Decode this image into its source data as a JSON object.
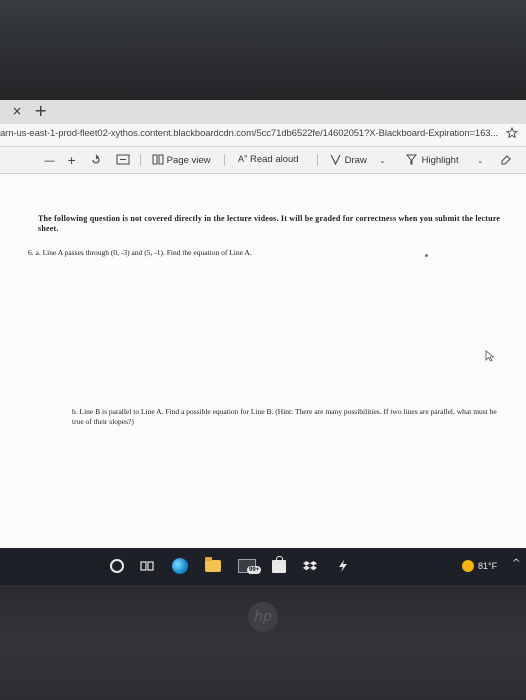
{
  "browser": {
    "tab_close_glyph": "×",
    "tab_new_glyph": "+",
    "url": "arn-us-east-1-prod-fleet02-xythos.content.blackboardcdn.com/5cc71db6522fe/14602051?X-Blackboard-Expiration=163...",
    "address_icon": "favorites-icon"
  },
  "pdf_toolbar": {
    "zoom_out": "—",
    "zoom_in": "+",
    "page_view_label": "Page view",
    "read_aloud_label": "Read aloud",
    "draw_label": "Draw",
    "highlight_label": "Highlight"
  },
  "document": {
    "instructions": "The following question is not covered directly in the lecture videos. It will be graded for correctness when you submit the lecture sheet.",
    "question_6a": "6.  a.  Line A passes through (0, -3) and (5, -1).  Find the equation of Line A.",
    "question_6b": "b.  Line B is parallel to Line A.  Find a possible equation for Line B.  (Hint:  There are many possibilities.  If two lines are parallel, what must be true of their slopes?)"
  },
  "taskbar": {
    "mail_badge": "99+",
    "temperature": "81°F"
  },
  "colors": {
    "taskbar_bg": "#1d2127",
    "doc_bg": "#fbfbfb",
    "weather_sun": "#f4b400"
  }
}
